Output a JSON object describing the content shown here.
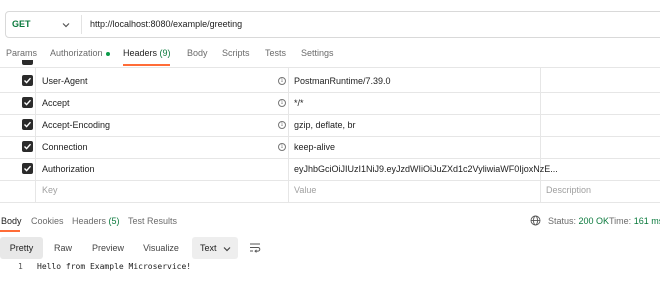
{
  "request": {
    "method": "GET",
    "url": "http://localhost:8080/example/greeting"
  },
  "tabs": {
    "params": "Params",
    "authorization": "Authorization",
    "headers": "Headers",
    "headers_count": "(9)",
    "body": "Body",
    "scripts": "Scripts",
    "tests": "Tests",
    "settings": "Settings"
  },
  "headers_table": {
    "rows": [
      {
        "key": "User-Agent",
        "value": "PostmanRuntime/7.39.0"
      },
      {
        "key": "Accept",
        "value": "*/*"
      },
      {
        "key": "Accept-Encoding",
        "value": "gzip, deflate, br"
      },
      {
        "key": "Connection",
        "value": "keep-alive"
      },
      {
        "key": "Authorization",
        "value": "eyJhbGciOiJIUzI1NiJ9.eyJzdWIiOiJuZXd1c2VyliwiaWF0IjoxNzE..."
      }
    ],
    "placeholder_key": "Key",
    "placeholder_value": "Value",
    "placeholder_description": "Description"
  },
  "response": {
    "tabs": {
      "body": "Body",
      "cookies": "Cookies",
      "headers": "Headers",
      "headers_count": "(5)",
      "test_results": "Test Results"
    },
    "status_label": "Status:",
    "status_value": "200 OK",
    "time_label": "Time:",
    "time_value": "161 ms",
    "views": {
      "pretty": "Pretty",
      "raw": "Raw",
      "preview": "Preview",
      "visualize": "Visualize"
    },
    "format": "Text",
    "line_number": "1",
    "body_text": "Hello from Example Microservice!"
  },
  "colors": {
    "accent": "#ff6c37",
    "method_get": "#0b7a3d",
    "status_ok": "#0b7a3d"
  }
}
